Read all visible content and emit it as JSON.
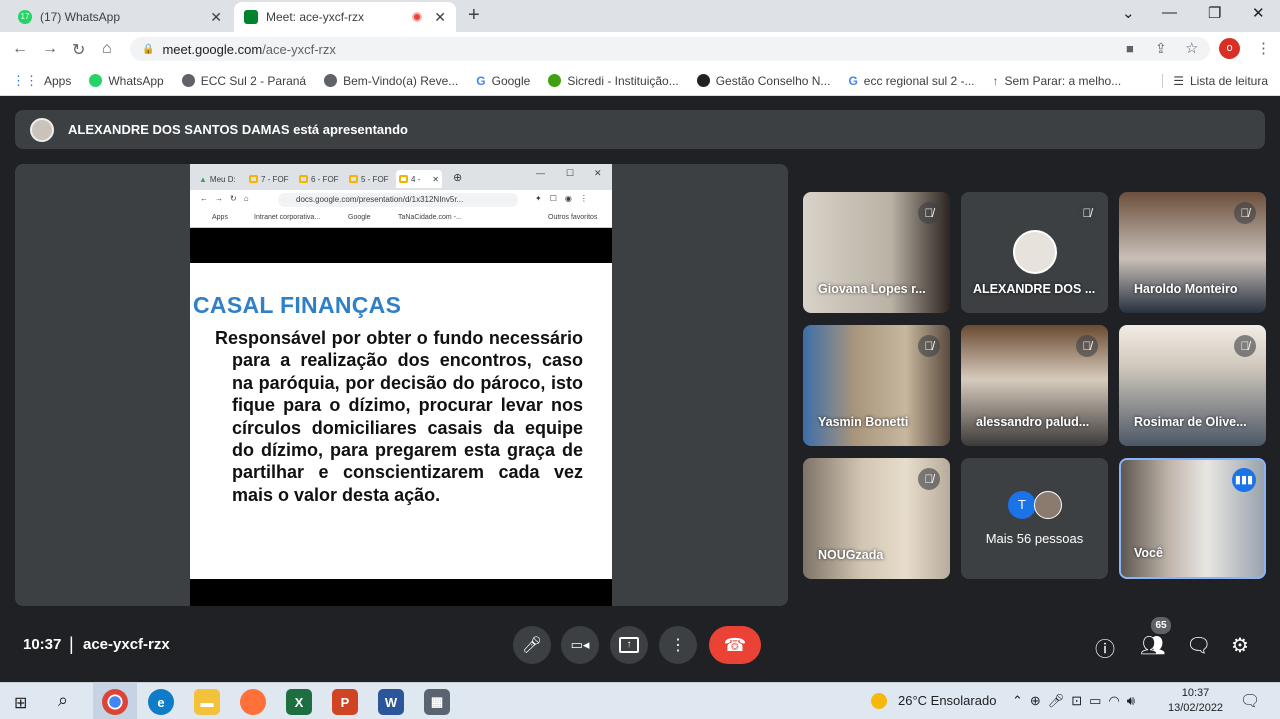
{
  "browser": {
    "tabs": [
      {
        "title": "(17) WhatsApp",
        "badge": "17"
      },
      {
        "title": "Meet: ace-yxcf-rzx"
      }
    ],
    "url_host": "meet.google.com",
    "url_path": "/ace-yxcf-rzx",
    "profile_initial": "o",
    "bookmarks": [
      "Apps",
      "WhatsApp",
      "ECC Sul 2 - Paraná",
      "Bem-Vindo(a) Reve...",
      "Google",
      "Sicredi - Instituição...",
      "Gestão Conselho N...",
      "ecc regional sul 2 -...",
      "Sem Parar: a melho..."
    ],
    "reading_list": "Lista de leitura"
  },
  "presenting_banner": "ALEXANDRE DOS SANTOS DAMAS está apresentando",
  "shared_screen": {
    "tabs": [
      "Meu D:",
      "7 - FOF",
      "6 - FOF",
      "5 - FOF",
      "4 -"
    ],
    "url": "docs.google.com/presentation/d/1x312NInv5r...",
    "bookmarks": [
      "Apps",
      "Intranet corporativa...",
      "Google",
      "TaNaCidade.com -...",
      "Outros favoritos"
    ],
    "slide_title": "CASAL FINANÇAS",
    "slide_body": "Responsável por obter o fundo necessário para a realização dos encontros, caso na paróquia, por decisão do pároco, isto fique para o dízimo, procurar levar nos círculos domiciliares casais da equipe do dízimo, para pregarem esta graça de partilhar e conscientizarem cada vez mais o valor desta ação."
  },
  "participants": [
    {
      "name": "Giovana Lopes r...",
      "muted": true
    },
    {
      "name": "ALEXANDRE DOS ...",
      "muted": true
    },
    {
      "name": "Haroldo Monteiro",
      "muted": true
    },
    {
      "name": "Yasmin Bonetti",
      "muted": true
    },
    {
      "name": "alessandro palud...",
      "muted": true
    },
    {
      "name": "Rosimar de Olive...",
      "muted": true
    },
    {
      "name": "NOUGzada",
      "muted": true
    },
    {
      "name": "Mais 56 pessoas",
      "avatar_letter": "T"
    },
    {
      "name": "Você",
      "speaking": true
    }
  ],
  "meeting": {
    "time": "10:37",
    "code": "ace-yxcf-rzx",
    "people_count": "65"
  },
  "taskbar": {
    "weather": "26°C  Ensolarado",
    "clock_time": "10:37",
    "clock_date": "13/02/2022"
  },
  "colors": {
    "accent_blue": "#1a73e8",
    "hangup_red": "#ea4335",
    "slide_title_blue": "#2f80c6"
  }
}
